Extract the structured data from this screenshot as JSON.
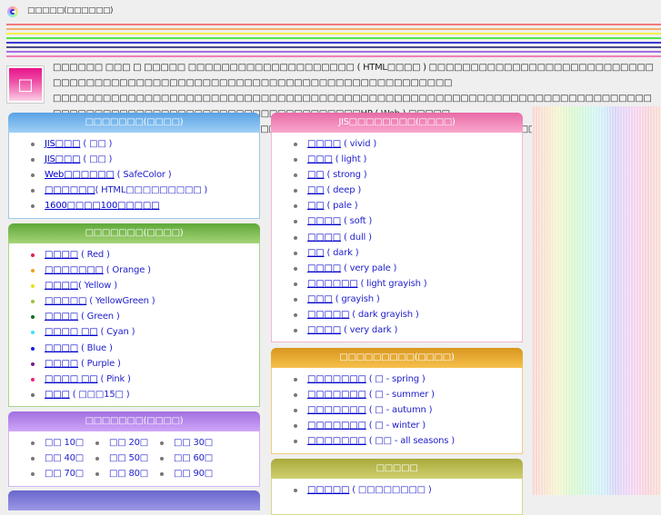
{
  "browser": {
    "tab_title": "□□□□□(□□□□□□)",
    "favicon": "site-logo-icon"
  },
  "header_rules": [
    "#f27b7b",
    "#f4b06e",
    "#f2f04a",
    "#4ee84e",
    "#3a3ad8",
    "#4a4a8a",
    "#a46ee8",
    "#f27fb8"
  ],
  "intro": {
    "icon": "color-swatch-icon",
    "icon_glyph": "□",
    "line1": "□□□□□□ □□□ □ □□□□□ □□□□□□□□□□□□□□□□□□□□ ( HTML□□□□ ) □□□□□□□□□□□□□□□□□□□□□□□□□□□□□□□□□□□□□□□□□□□□□□□□□□□□□□□□□□□□□□□□□□□□□□□□□□□",
    "line2": "□□□□□□□□□□□□□□□□□□□□□□□□□□□□□□□□□□□□□□□□□□□□□□□□□□□□□□□□□□□□□□□□□□□□□□□□□□□□□□□□□□□□□□□□□□□□□□□□□□□□□□□□□□□□□HP ( Web ) □□□□□",
    "line3": "□□□□□HTML□□□□□ ( □□ ) □□□□□□□□□□□□□□□□□□□□□□□□□□□□□□□□□※ □□□□□□□□□□□□□□□□□□□□□ ",
    "link": "□□□□□□",
    "line3_end": " □□□□□□□"
  },
  "sections": {
    "color_tables": {
      "title": "□□□□□□□(□□□□)",
      "items": [
        {
          "jp": "JIS□□□",
          "en": " ( □□ )"
        },
        {
          "jp": "JIS□□□",
          "en": " ( □□ )"
        },
        {
          "jp": "Web□□□□□□",
          "en": " ( SafeColor )"
        },
        {
          "jp": "□□□□□□",
          "en": "( HTML□□□□□□□□□ )"
        },
        {
          "jp": "1600□□□□100□□□□□",
          "en": ""
        }
      ]
    },
    "color_families": {
      "title": "□□□□□□□(□□□□)",
      "items": [
        {
          "jp": "□□□□",
          "en": " ( Red )",
          "dot": "#e0205a"
        },
        {
          "jp": "□□□□□□□",
          "en": " ( Orange )",
          "dot": "#f0a020"
        },
        {
          "jp": "□□□□",
          "en": "( Yellow )",
          "dot": "#e8e020"
        },
        {
          "jp": "□□□□□",
          "en": " ( YellowGreen )",
          "dot": "#a0c040"
        },
        {
          "jp": "□□□□",
          "en": " ( Green )",
          "dot": "#107020"
        },
        {
          "jp": "□□□□ □□",
          "en": " ( Cyan )",
          "dot": "#40e0f0"
        },
        {
          "jp": "□□□□",
          "en": " ( Blue )",
          "dot": "#1020e0"
        },
        {
          "jp": "□□□□",
          "en": " ( Purple )",
          "dot": "#702080"
        },
        {
          "jp": "□□□□ □□",
          "en": " ( Pink )",
          "dot": "#f02080"
        },
        {
          "jp": "□□□",
          "en": " ( □□□15□ )",
          "dot": "#707070"
        }
      ]
    },
    "age_groups": {
      "title": "□□□□□□□(□□□□)",
      "items": [
        {
          "label": "□□ 10□"
        },
        {
          "label": "□□ 20□"
        },
        {
          "label": "□□ 30□"
        },
        {
          "label": "□□ 40□"
        },
        {
          "label": "□□ 50□"
        },
        {
          "label": "□□ 60□"
        },
        {
          "label": "□□ 70□"
        },
        {
          "label": "□□ 80□"
        },
        {
          "label": "□□ 90□"
        }
      ]
    },
    "jis_tones": {
      "title": "JIS□□□□□□□□(□□□□)",
      "items": [
        {
          "jp": "□□□□",
          "en": " ( vivid )"
        },
        {
          "jp": "□□□",
          "en": " ( light )"
        },
        {
          "jp": "□□",
          "en": " ( strong )"
        },
        {
          "jp": "□□",
          "en": " ( deep )"
        },
        {
          "jp": "□□",
          "en": " ( pale )"
        },
        {
          "jp": "□□□□",
          "en": " ( soft )"
        },
        {
          "jp": "□□□□",
          "en": " ( dull )"
        },
        {
          "jp": "□□",
          "en": " ( dark )"
        },
        {
          "jp": "□□□□",
          "en": " ( very pale )"
        },
        {
          "jp": "□□□□□□",
          "en": " ( light grayish )"
        },
        {
          "jp": "□□□",
          "en": " ( grayish )"
        },
        {
          "jp": "□□□□□",
          "en": " ( dark grayish )"
        },
        {
          "jp": "□□□□",
          "en": " ( very dark )"
        }
      ]
    },
    "seasons": {
      "title": "□□□□□□□□□(□□□□)",
      "items": [
        {
          "jp": "□□□□□□□",
          "en": " ( □ - spring )"
        },
        {
          "jp": "□□□□□□□",
          "en": " ( □ - summer )"
        },
        {
          "jp": "□□□□□□□",
          "en": " ( □ - autumn )"
        },
        {
          "jp": "□□□□□□□",
          "en": " ( □ - winter )"
        },
        {
          "jp": "□□□□□□□",
          "en": " ( □□ - all seasons )"
        }
      ]
    },
    "misc": {
      "title": "□□□□□",
      "items": [
        {
          "jp": "□□□□□",
          "en": " ( □□□□□□□□ )"
        }
      ]
    }
  }
}
